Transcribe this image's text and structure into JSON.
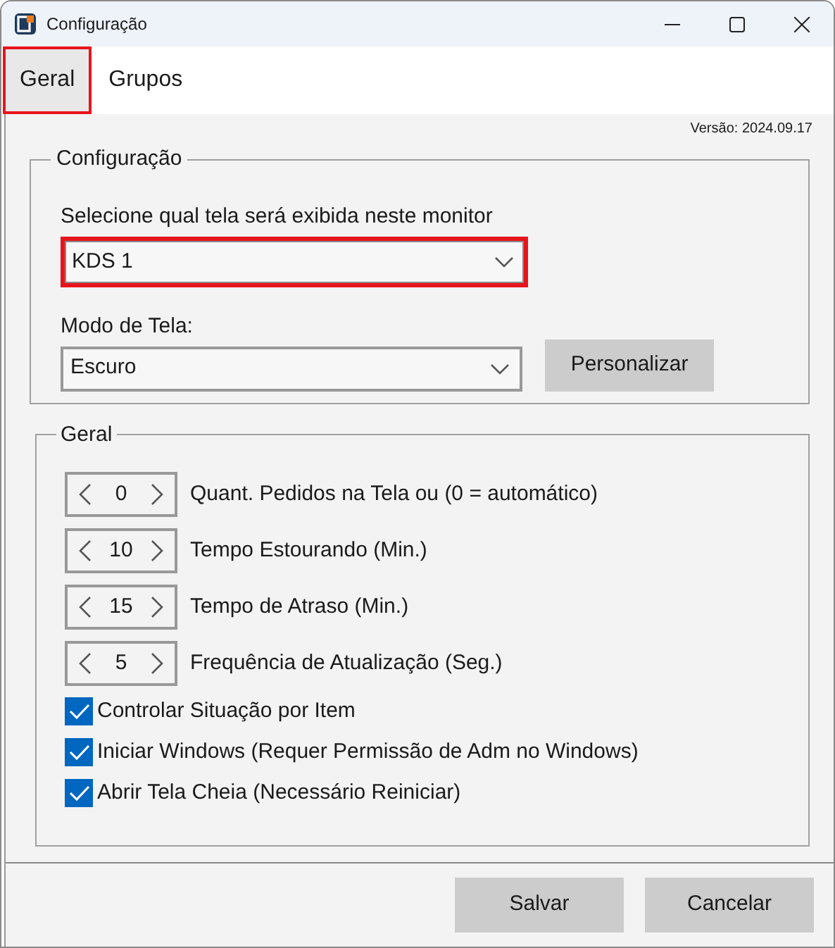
{
  "window": {
    "title": "Configuração"
  },
  "tabs": [
    {
      "label": "Geral",
      "selected": true,
      "highlighted": true
    },
    {
      "label": "Grupos",
      "selected": false,
      "highlighted": false
    }
  ],
  "version": "Versão: 2024.09.17",
  "config_group": {
    "title": "Configuração",
    "screen_label": "Selecione qual tela será exibida neste monitor",
    "screen_value": "KDS 1",
    "screen_highlighted": true,
    "mode_label": "Modo de Tela:",
    "mode_value": "Escuro",
    "customize_button": "Personalizar"
  },
  "general_group": {
    "title": "Geral",
    "spinners": [
      {
        "value": "0",
        "label": "Quant. Pedidos na Tela ou (0 = automático)"
      },
      {
        "value": "10",
        "label": "Tempo Estourando (Min.)"
      },
      {
        "value": "15",
        "label": "Tempo de Atraso (Min.)"
      },
      {
        "value": "5",
        "label": "Frequência de Atualização (Seg.)"
      }
    ],
    "checkboxes": [
      {
        "label": "Controlar Situação por Item",
        "checked": true
      },
      {
        "label": "Iniciar Windows (Requer Permissão de Adm no Windows)",
        "checked": true
      },
      {
        "label": "Abrir Tela Cheia (Necessário Reiniciar)",
        "checked": true
      }
    ]
  },
  "buttons": [
    "Salvar",
    "Cancelar"
  ]
}
